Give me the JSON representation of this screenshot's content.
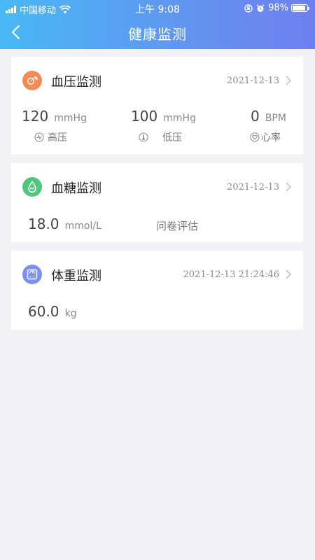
{
  "status_bar": {
    "carrier": "中国移动",
    "time": "上午 9:08",
    "battery": "98%"
  },
  "nav": {
    "title": "健康监测"
  },
  "cards": {
    "blood_pressure": {
      "title": "血压监测",
      "date": "2021-12-13",
      "icon": "blood-pressure-icon",
      "icon_color": "#f48a54",
      "metrics": [
        {
          "value": "120",
          "unit": "mmHg",
          "label": "高压"
        },
        {
          "value": "100",
          "unit": "mmHg",
          "label": "低压"
        },
        {
          "value": "0",
          "unit": "BPM",
          "label": "心率"
        }
      ]
    },
    "blood_sugar": {
      "title": "血糖监测",
      "date": "2021-12-13",
      "icon": "blood-drop-icon",
      "icon_color": "#4fc77a",
      "value": "18.0",
      "unit": "mmol/L",
      "questionnaire": "问卷评估"
    },
    "weight": {
      "title": "体重监测",
      "date": "2021-12-13 21:24:46",
      "icon": "scale-icon",
      "icon_color": "#7b8ff0",
      "value": "60.0",
      "unit": "kg"
    }
  }
}
